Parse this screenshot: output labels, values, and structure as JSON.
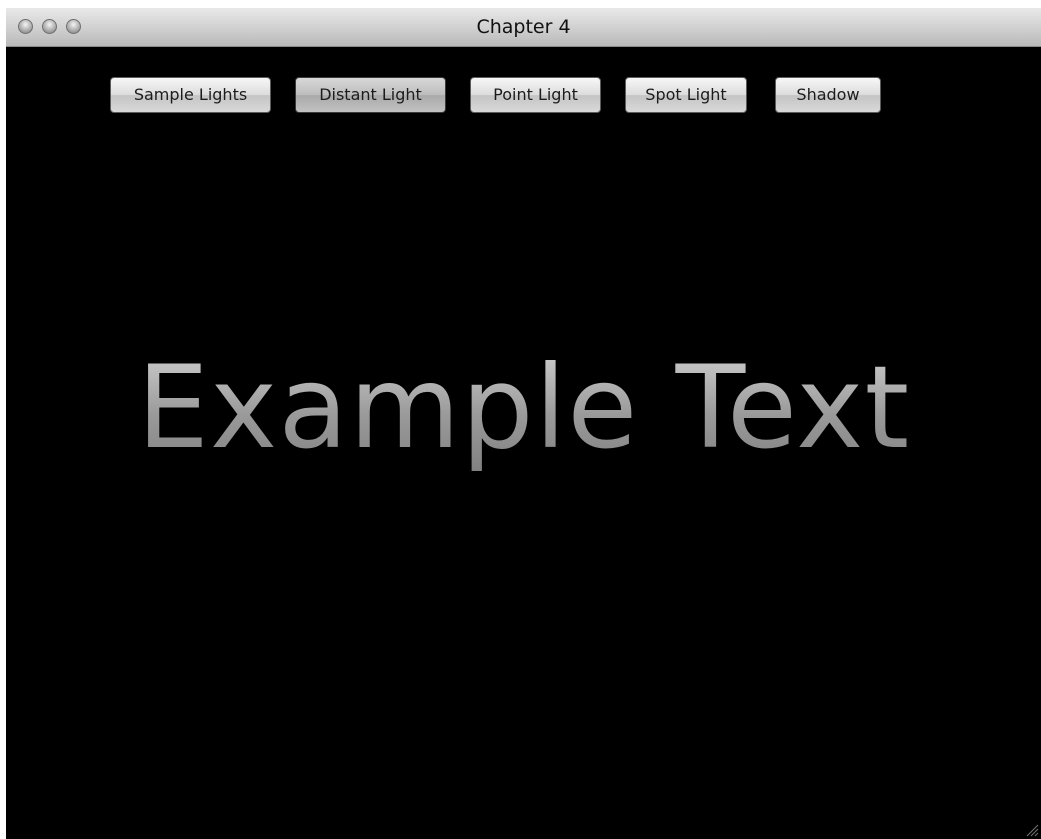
{
  "window": {
    "title": "Chapter 4"
  },
  "toolbar": {
    "buttons": [
      {
        "label": "Sample Lights"
      },
      {
        "label": "Distant Light"
      },
      {
        "label": "Point Light"
      },
      {
        "label": "Spot Light"
      },
      {
        "label": "Shadow"
      }
    ]
  },
  "canvas": {
    "text": "Example Text",
    "background": "#000000",
    "text_color": "#a9a9a9"
  },
  "icons": {
    "close": "close-button-icon",
    "minimize": "minimize-button-icon",
    "zoom": "zoom-button-icon",
    "resize": "resize-grip-icon"
  }
}
